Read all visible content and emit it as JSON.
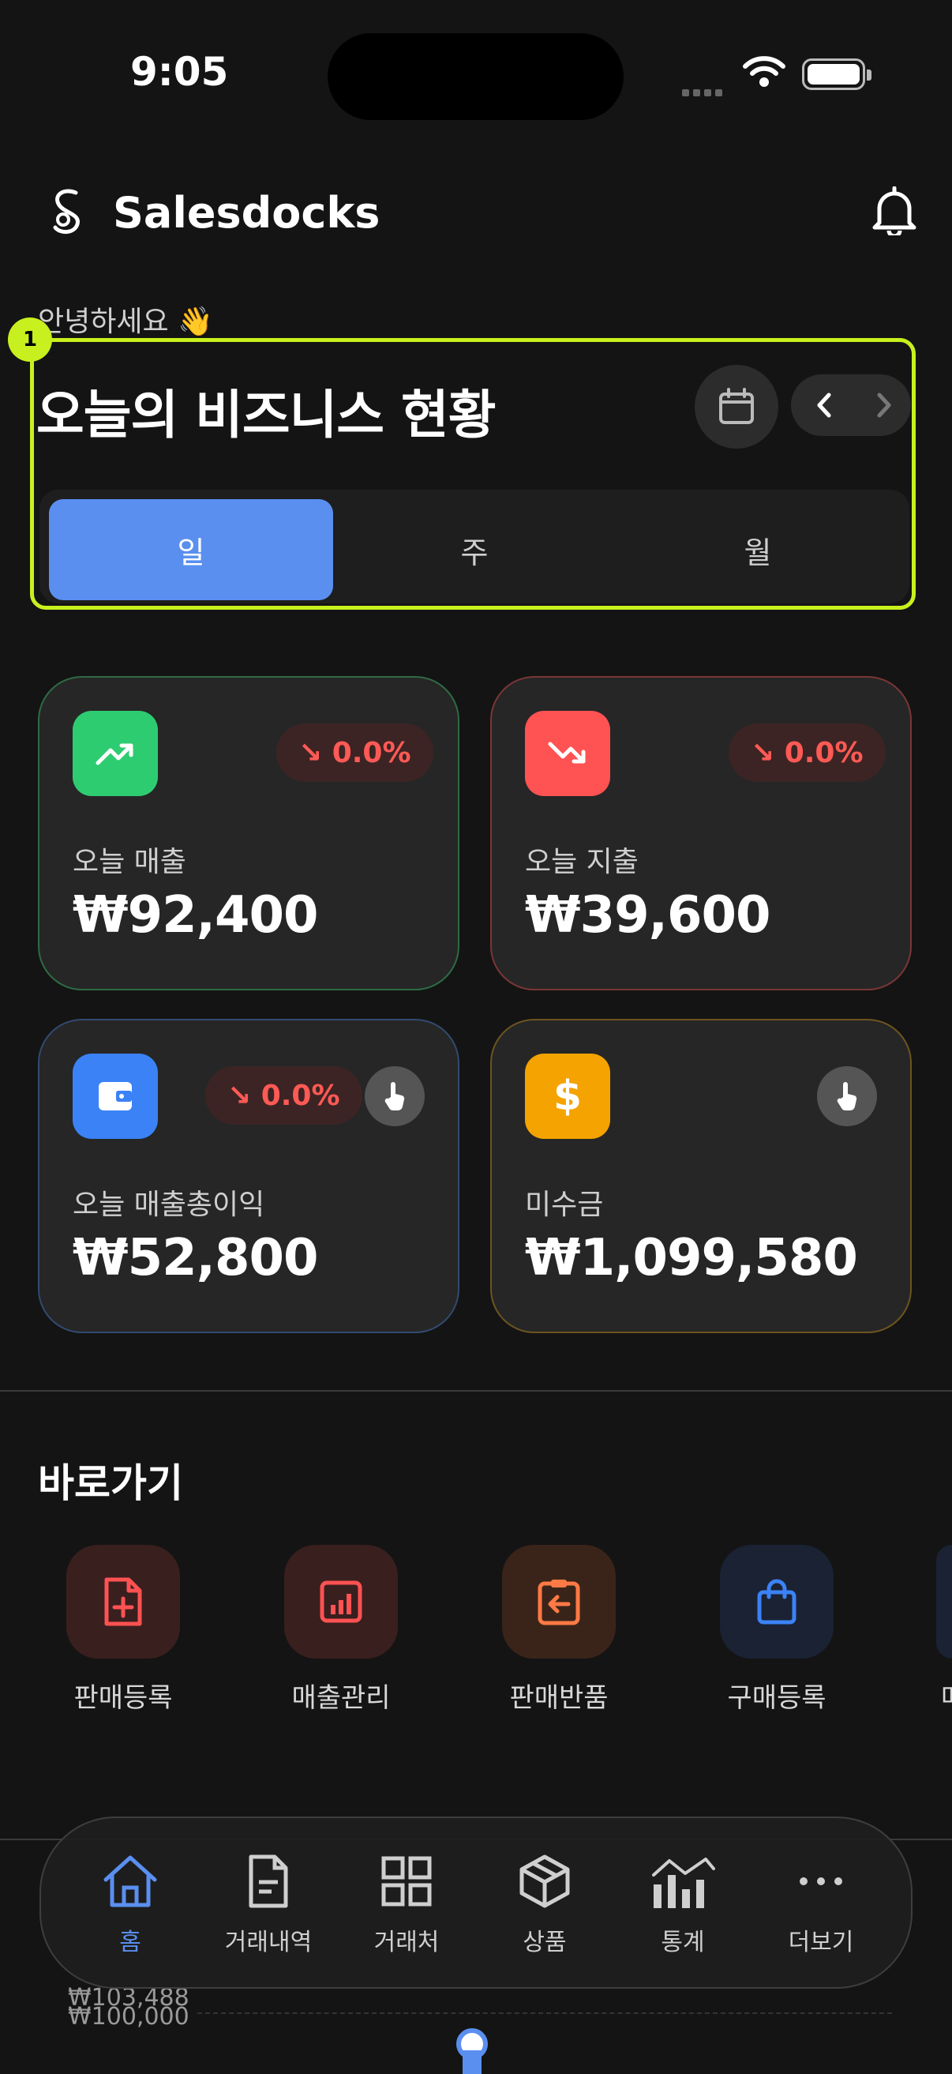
{
  "status_bar": {
    "time": "9:05"
  },
  "header": {
    "brand": "Salesdocks",
    "logo_icon": "salesdocks-logo",
    "bell_icon": "bell-icon"
  },
  "greeting": "안녕하세요 👋",
  "highlight": {
    "badge": "1",
    "color": "#c8f01e"
  },
  "overview": {
    "title": "오늘의 비즈니스 현황",
    "calendar_icon": "calendar-icon",
    "prev_icon": "chevron-left-icon",
    "next_icon": "chevron-right-icon",
    "period_tabs": [
      {
        "label": "일",
        "active": true
      },
      {
        "label": "주",
        "active": false
      },
      {
        "label": "월",
        "active": false
      }
    ]
  },
  "cards": [
    {
      "label": "오늘 매출",
      "value": "₩92,400",
      "change": "↘ 0.0%",
      "icon": "trending-up-icon",
      "icon_color": "#2ecc71",
      "border": "#2e6b44"
    },
    {
      "label": "오늘 지출",
      "value": "₩39,600",
      "change": "↘ 0.0%",
      "icon": "trending-down-icon",
      "icon_color": "#ff5252",
      "border": "#7a3636"
    },
    {
      "label": "오늘 매출총이익",
      "value": "₩52,800",
      "change": "↘ 0.0%",
      "icon": "wallet-icon",
      "icon_color": "#3b82f6",
      "border": "#324a70"
    },
    {
      "label": "미수금",
      "value": "₩1,099,580",
      "icon": "dollar-icon",
      "icon_color": "#f5a300",
      "border": "#6d5420"
    }
  ],
  "shortcuts": {
    "title": "바로가기",
    "items": [
      {
        "label": "판매등록",
        "icon": "file-plus-icon"
      },
      {
        "label": "매출관리",
        "icon": "chart-report-icon"
      },
      {
        "label": "판매반품",
        "icon": "clipboard-return-icon"
      },
      {
        "label": "구매등록",
        "icon": "shopping-bag-icon"
      },
      {
        "label": "매",
        "icon": "partial-icon"
      }
    ]
  },
  "chart_peek": {
    "label1": "₩103,488",
    "label2": "₩100,000"
  },
  "tab_bar": [
    {
      "label": "홈",
      "icon": "home-icon",
      "active": true
    },
    {
      "label": "거래내역",
      "icon": "document-icon",
      "active": false
    },
    {
      "label": "거래처",
      "icon": "grid-icon",
      "active": false
    },
    {
      "label": "상품",
      "icon": "box-icon",
      "active": false
    },
    {
      "label": "통계",
      "icon": "stats-icon",
      "active": false
    },
    {
      "label": "더보기",
      "icon": "more-icon",
      "active": false
    }
  ]
}
